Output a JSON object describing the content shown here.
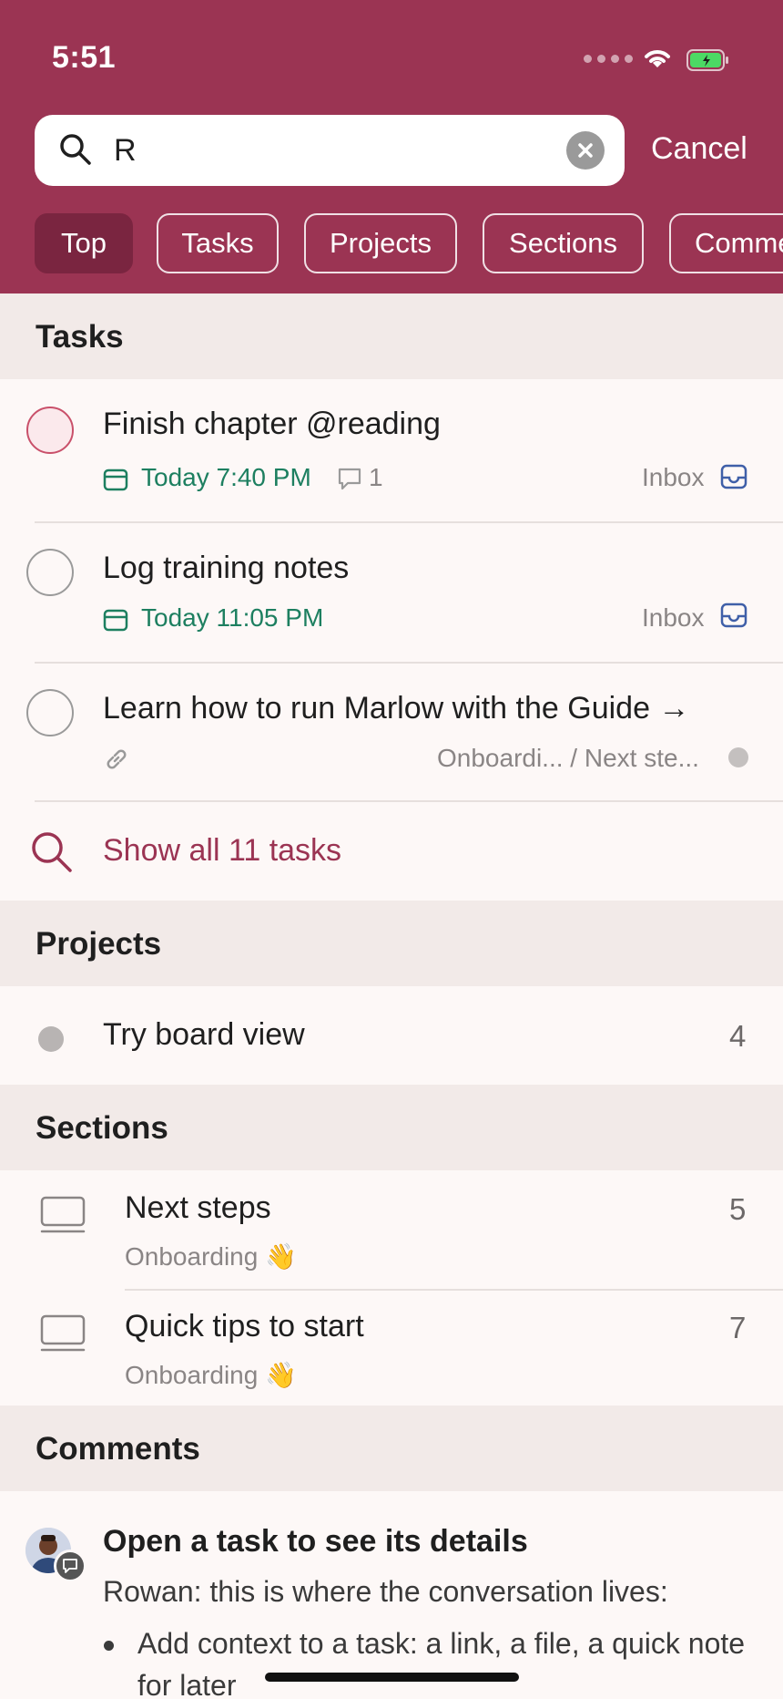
{
  "status_bar": {
    "time": "5:51"
  },
  "search": {
    "value": "R",
    "cancel_label": "Cancel"
  },
  "filters": [
    {
      "label": "Top",
      "active": true
    },
    {
      "label": "Tasks",
      "active": false
    },
    {
      "label": "Projects",
      "active": false
    },
    {
      "label": "Sections",
      "active": false
    },
    {
      "label": "Comme",
      "active": false
    }
  ],
  "tasks_section": {
    "title": "Tasks",
    "items": [
      {
        "title": "Finish chapter @reading",
        "date": "Today 7:40 PM",
        "comments": "1",
        "project": "Inbox",
        "priority": "p1"
      },
      {
        "title": "Log training notes",
        "date": "Today 11:05 PM",
        "project": "Inbox"
      },
      {
        "title": "Learn how to run Marlow with the Guide →",
        "project": "Onboardi... / Next ste..."
      }
    ],
    "show_all": "Show all 11 tasks"
  },
  "projects_section": {
    "title": "Projects",
    "items": [
      {
        "name": "Try board view",
        "count": "4"
      }
    ]
  },
  "sections_section": {
    "title": "Sections",
    "items": [
      {
        "name": "Next steps",
        "project": "Onboarding 👋",
        "count": "5"
      },
      {
        "name": "Quick tips to start",
        "project": "Onboarding 👋",
        "count": "7"
      }
    ]
  },
  "comments_section": {
    "title": "Comments",
    "items": [
      {
        "title": "Open a task to see its details",
        "body": "Rowan: this is where the conversation lives:",
        "bullet": "Add context to a task: a link, a file, a quick note for later"
      }
    ]
  },
  "colors": {
    "brand": "#9b3453",
    "date_green": "#1d7f60",
    "inbox_blue": "#3f5fa8"
  }
}
